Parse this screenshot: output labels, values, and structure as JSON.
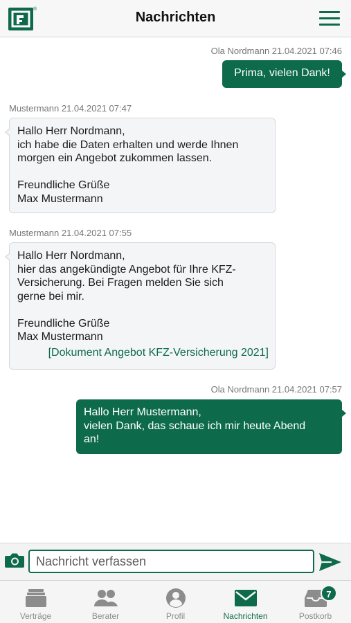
{
  "header": {
    "title": "Nachrichten",
    "logo": "company-logo",
    "menu_icon": "hamburger-menu-icon"
  },
  "messages": [
    {
      "direction": "outgoing",
      "meta": "Ola Nordmann 21.04.2021 07:46",
      "lines": [
        "Prima, vielen Dank!"
      ]
    },
    {
      "direction": "incoming",
      "meta": "Mustermann 21.04.2021 07:47",
      "lines": [
        "Hallo Herr Nordmann,",
        "ich habe die Daten erhalten und werde Ihnen",
        "morgen ein Angebot zukommen lassen.",
        "",
        "Freundliche Grüße",
        "Max Mustermann"
      ]
    },
    {
      "direction": "incoming",
      "meta": "Mustermann 21.04.2021 07:55",
      "lines": [
        "Hallo Herr Nordmann,",
        "hier das angekündigte Angebot für Ihre KFZ-",
        "Versicherung. Bei Fragen melden Sie sich",
        "gerne bei mir.",
        "",
        "Freundliche Grüße",
        "Max Mustermann"
      ],
      "attachment": "[Dokument Angebot KFZ-Versicherung 2021]"
    },
    {
      "direction": "outgoing",
      "meta": "Ola Nordmann 21.04.2021 07:57",
      "lines": [
        "Hallo Herr Mustermann,",
        "vielen Dank, das schaue ich mir heute Abend",
        "an!"
      ]
    }
  ],
  "composer": {
    "placeholder": "Nachricht verfassen",
    "value": "",
    "camera_icon": "camera-icon",
    "send_icon": "send-icon"
  },
  "tabs": [
    {
      "label": "Verträge",
      "icon": "contracts-icon",
      "active": false
    },
    {
      "label": "Berater",
      "icon": "advisors-icon",
      "active": false
    },
    {
      "label": "Profil",
      "icon": "profile-icon",
      "active": false
    },
    {
      "label": "Nachrichten",
      "icon": "envelope-icon",
      "active": true
    },
    {
      "label": "Postkorb",
      "icon": "inbox-tray-icon",
      "active": false,
      "badge": "7"
    }
  ],
  "colors": {
    "brand": "#0d6b4b",
    "incoming_bubble": "#f4f5f7",
    "inactive_tab": "#8c8c8c"
  }
}
